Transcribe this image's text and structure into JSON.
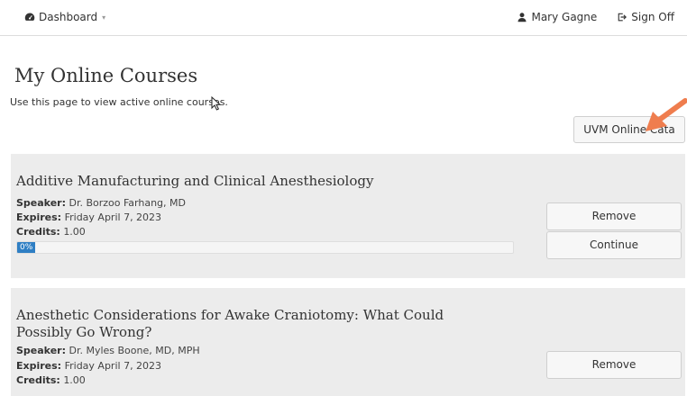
{
  "nav": {
    "dashboard_label": "Dashboard",
    "dashboard_icon": "dashboard-icon",
    "user_name": "Mary Gagne",
    "user_icon": "user-icon",
    "signoff_label": "Sign Off",
    "signoff_icon": "sign-out-icon"
  },
  "page": {
    "title": "My Online Courses",
    "subtitle": "Use this page to view active online courses.",
    "uvm_button": "UVM Online Cata"
  },
  "courses": [
    {
      "title": "Additive Manufacturing and Clinical Anesthesiology",
      "speaker_label": "Speaker:",
      "speaker": "Dr. Borzoo Farhang, MD",
      "expires_label": "Expires:",
      "expires": "Friday April 7, 2023",
      "credits_label": "Credits:",
      "credits": "1.00",
      "progress_percent": 0,
      "progress_text": "0%",
      "remove_label": "Remove",
      "continue_label": "Continue"
    },
    {
      "title": "Anesthetic Considerations for Awake Craniotomy: What Could Possibly Go Wrong?",
      "speaker_label": "Speaker:",
      "speaker": "Dr. Myles Boone, MD, MPH",
      "expires_label": "Expires:",
      "expires": "Friday April 7, 2023",
      "credits_label": "Credits:",
      "credits": "1.00",
      "remove_label": "Remove"
    }
  ],
  "colors": {
    "progress": "#2f7fc4",
    "arrow": "#ef7d4e",
    "card_bg": "#ececec"
  }
}
